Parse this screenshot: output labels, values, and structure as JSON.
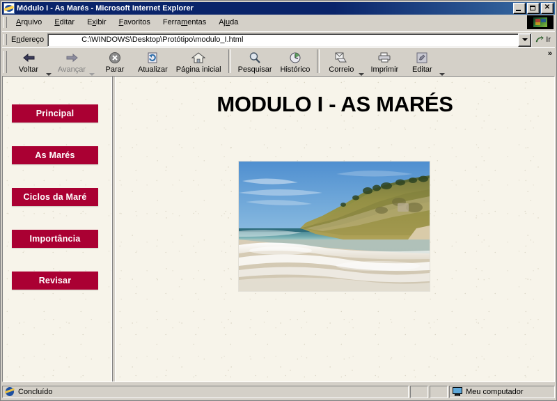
{
  "window": {
    "title": "Módulo I - As Marés - Microsoft Internet Explorer",
    "minimize_label": "_",
    "maximize_label": "",
    "close_label": "✕"
  },
  "menubar": {
    "items": [
      {
        "label": "Arquivo",
        "accel": "A"
      },
      {
        "label": "Editar",
        "accel": "E"
      },
      {
        "label": "Exibir",
        "accel": "x"
      },
      {
        "label": "Favoritos",
        "accel": "F"
      },
      {
        "label": "Ferramentas",
        "accel": "m"
      },
      {
        "label": "Ajuda",
        "accel": "u"
      }
    ]
  },
  "address_bar": {
    "label": "Endereço",
    "value": "C:\\WINDOWS\\Desktop\\Protótipo\\modulo_I.html",
    "placeholder": "Endereço",
    "go_label": "Ir"
  },
  "toolbar": {
    "overflow_label": "»",
    "buttons": [
      {
        "label": "Voltar",
        "icon": "back-arrow-icon",
        "enabled": true,
        "has_caret": true
      },
      {
        "label": "Avançar",
        "icon": "forward-arrow-icon",
        "enabled": false,
        "has_caret": true
      },
      {
        "label": "Parar",
        "icon": "stop-icon",
        "enabled": true,
        "has_caret": false
      },
      {
        "label": "Atualizar",
        "icon": "refresh-icon",
        "enabled": true,
        "has_caret": false
      },
      {
        "label": "Página inicial",
        "icon": "home-icon",
        "enabled": true,
        "has_caret": false
      },
      {
        "label": "Pesquisar",
        "icon": "search-icon",
        "enabled": true,
        "has_caret": false
      },
      {
        "label": "Histórico",
        "icon": "history-icon",
        "enabled": true,
        "has_caret": false
      },
      {
        "label": "Correio",
        "icon": "mail-icon",
        "enabled": true,
        "has_caret": true
      },
      {
        "label": "Imprimir",
        "icon": "printer-icon",
        "enabled": true,
        "has_caret": false
      },
      {
        "label": "Editar",
        "icon": "edit-page-icon",
        "enabled": true,
        "has_caret": true
      }
    ]
  },
  "sidebar": {
    "items": [
      {
        "label": "Principal"
      },
      {
        "label": "As Marés"
      },
      {
        "label": "Ciclos da Maré"
      },
      {
        "label": "Importância"
      },
      {
        "label": "Revisar"
      }
    ]
  },
  "page": {
    "title": "MODULO I - AS MARÉS",
    "image_alt": "beach-with-headland-photo"
  },
  "statusbar": {
    "status": "Concluído",
    "zone": "Meu computador"
  },
  "colors": {
    "nav_button": "#aa0033",
    "nav_button_text": "#ffffff",
    "page_background": "#f7f4ea",
    "title_text": "#000000",
    "titlebar_start": "#0a246a",
    "titlebar_end": "#3a6ea5",
    "chrome": "#d4d0c8"
  }
}
